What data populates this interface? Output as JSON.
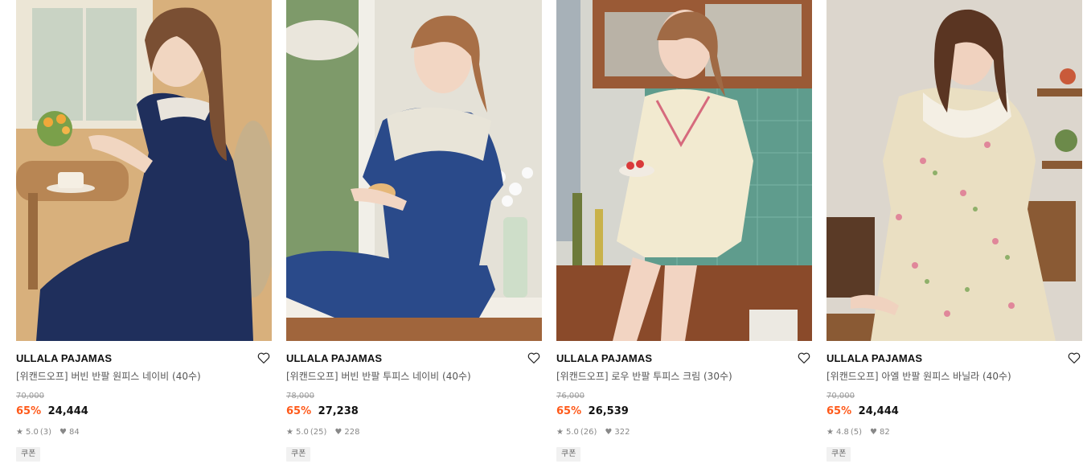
{
  "products": [
    {
      "brand": "ULLALA PAJAMAS",
      "name": "[위캔드오프] 버빈 반팔 원피스 네이비 (40수)",
      "original_price": "70,000",
      "discount": "65%",
      "price": "24,444",
      "rating": "5.0",
      "reviews": "(3)",
      "likes": "84",
      "coupon": "쿠폰",
      "image_theme": "navy-dress",
      "colors": {
        "bg": "#d9b27e",
        "garment": "#1f2f5c",
        "accent": "#e8a84d"
      }
    },
    {
      "brand": "ULLALA PAJAMAS",
      "name": "[위캔드오프] 버빈 반팔 투피스 네이비 (40수)",
      "original_price": "78,000",
      "discount": "65%",
      "price": "27,238",
      "rating": "5.0",
      "reviews": "(25)",
      "likes": "228",
      "coupon": "쿠폰",
      "image_theme": "navy-twopiece",
      "colors": {
        "bg": "#e6e2d6",
        "garment": "#2a4a8a",
        "accent": "#8fb06a"
      }
    },
    {
      "brand": "ULLALA PAJAMAS",
      "name": "[위캔드오프] 로우 반팔 투피스 크림 (30수)",
      "original_price": "76,000",
      "discount": "65%",
      "price": "26,539",
      "rating": "5.0",
      "reviews": "(26)",
      "likes": "322",
      "coupon": "쿠폰",
      "image_theme": "cream-twopiece",
      "colors": {
        "bg": "#c9cbc4",
        "garment": "#f2ead0",
        "accent": "#5b9e8e"
      }
    },
    {
      "brand": "ULLALA PAJAMAS",
      "name": "[위캔드오프] 아엘 반팔 원피스 바닐라 (40수)",
      "original_price": "70,000",
      "discount": "65%",
      "price": "24,444",
      "rating": "4.8",
      "reviews": "(5)",
      "likes": "82",
      "coupon": "쿠폰",
      "image_theme": "vanilla-dress",
      "colors": {
        "bg": "#ddd7cf",
        "garment": "#eadfc2",
        "accent": "#e0879a"
      }
    }
  ],
  "icons": {
    "wishlist": "heart-outline-icon",
    "rating": "star-icon",
    "likes": "heart-filled-icon"
  },
  "accent_color": "#ff5a1a"
}
